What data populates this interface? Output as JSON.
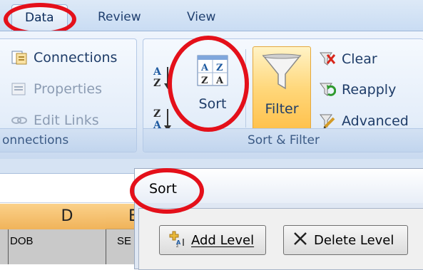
{
  "tabs": [
    {
      "label": "Data",
      "active": true
    },
    {
      "label": "Review",
      "active": false
    },
    {
      "label": "View",
      "active": false
    }
  ],
  "connections_group": {
    "buttons": [
      {
        "label": "Connections",
        "enabled": true,
        "icon": "connections-icon"
      },
      {
        "label": "Properties",
        "enabled": false,
        "icon": "properties-icon"
      },
      {
        "label": "Edit Links",
        "enabled": false,
        "icon": "edit-links-icon"
      }
    ],
    "label": "onnections"
  },
  "sort_filter_group": {
    "sort_label": "Sort",
    "filter_label": "Filter",
    "clear_label": "Clear",
    "reapply_label": "Reapply",
    "advanced_label": "Advanced",
    "label": "Sort & Filter",
    "icons": {
      "sort_az": "A↓Z",
      "sort_za": "Z↓A",
      "sort_box": [
        "A",
        "Z",
        "Z",
        "A"
      ]
    }
  },
  "sheet": {
    "columns": [
      "D",
      "E"
    ],
    "cells": [
      "DOB",
      "SE"
    ]
  },
  "dialog": {
    "title": "Sort",
    "add_level_label": "Add Level",
    "delete_level_label": "Delete Level"
  },
  "colors": {
    "highlight": "#e4101a",
    "filter_button": "#ffc04a",
    "column_header": "#f0b35a"
  }
}
